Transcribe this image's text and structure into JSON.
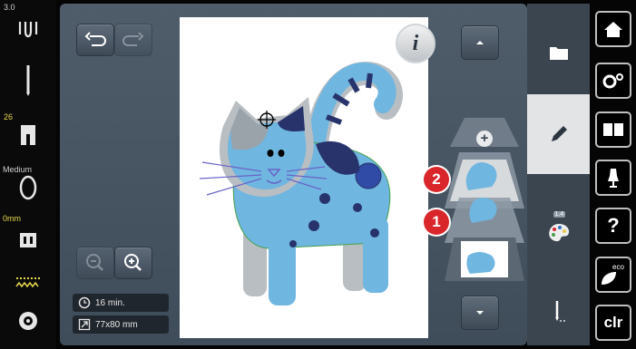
{
  "left_panel": {
    "needle_number": "3.0",
    "tension_value": "26",
    "speed_label": "Medium",
    "width_label": "0mm"
  },
  "info": {
    "time": "16 min.",
    "size": "77x80 mm"
  },
  "layers": {
    "badge_top": "2",
    "badge_bottom": "1",
    "plus_label": "+",
    "layer_count": "1.4"
  },
  "right_buttons": {
    "eco_label": "eco",
    "clr_label": "clr",
    "help_label": "?"
  },
  "icons": [
    "thread-icon",
    "needle-icon",
    "presser-foot-icon",
    "stitch-width-icon",
    "plate-icon",
    "bobbin-icon",
    "undo-icon",
    "redo-icon",
    "info-icon",
    "scroll-up-icon",
    "scroll-down-icon",
    "zoom-out-icon",
    "zoom-in-icon",
    "clock-icon",
    "size-icon",
    "folder-icon",
    "pencil-icon",
    "palette-icon",
    "stitch-out-icon",
    "home-icon",
    "settings-icon",
    "book-icon",
    "dress-form-icon",
    "help-icon",
    "eco-icon"
  ],
  "colors": {
    "accent_red": "#d8262a",
    "panel": "#4a5663",
    "tab_active": "#e2e4e6"
  }
}
